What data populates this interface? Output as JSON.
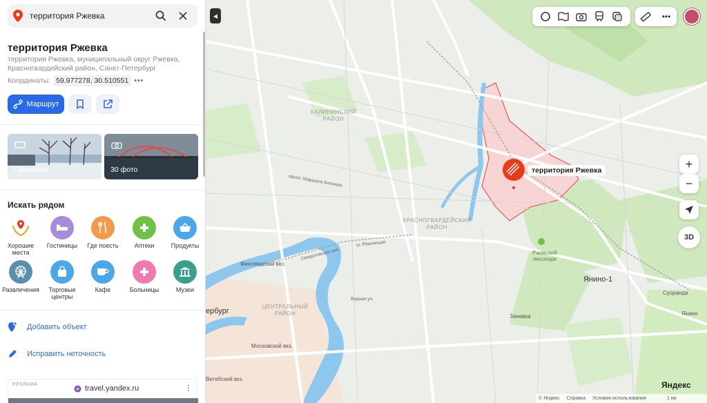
{
  "search": {
    "query": "территория Ржевка",
    "search_icon": "search-icon",
    "close_icon": "close-icon"
  },
  "place": {
    "title": "территория Ржевка",
    "address": "территория Ржевка, муниципальный округ Ржевка, Красногвардейский район, Санкт-Петербург",
    "coords_label": "Координаты:",
    "coords_value": "59.977278, 30.510551",
    "coords_more": "•••"
  },
  "actions": {
    "route_label": "Маршрут",
    "bookmark_icon": "bookmark-icon",
    "share_icon": "share-icon"
  },
  "photos": {
    "panorama_label": "Панорама",
    "photos_label": "30 фото"
  },
  "nearby": {
    "title": "Искать рядом",
    "items": [
      {
        "label": "Хорошие места",
        "icon": "award-icon",
        "color": "#f1f1f1"
      },
      {
        "label": "Гостиницы",
        "icon": "bed-icon",
        "color": "#a88cdc"
      },
      {
        "label": "Где поесть",
        "icon": "fork-knife-icon",
        "color": "#f39a4a"
      },
      {
        "label": "Аптеки",
        "icon": "plus-icon",
        "color": "#6ec246"
      },
      {
        "label": "Продукты",
        "icon": "basket-icon",
        "color": "#4aa8e8"
      },
      {
        "label": "Развлечения",
        "icon": "ferris-wheel-icon",
        "color": "#5a8fb0"
      },
      {
        "label": "Торговые центры",
        "icon": "shopping-bag-icon",
        "color": "#4aa8e8"
      },
      {
        "label": "Кафе",
        "icon": "coffee-icon",
        "color": "#4aa8e8"
      },
      {
        "label": "Больницы",
        "icon": "hospital-icon",
        "color": "#f07ab0"
      },
      {
        "label": "Музеи",
        "icon": "museum-icon",
        "color": "#3aa08a"
      }
    ]
  },
  "links": {
    "add_object": "Добавить объект",
    "fix_error": "Исправить неточность"
  },
  "ad": {
    "tag": "РЕКЛАМА",
    "site": "travel.yandex.ru",
    "menu": "⋮"
  },
  "map": {
    "marker_label": "территория Ржевка",
    "zoom_in": "+",
    "zoom_out": "−",
    "btn_3d": "3D",
    "logo": "Яндекс",
    "footer_copyright": "© Яндекс",
    "footer_help": "Справка",
    "footer_terms": "Условия использования",
    "footer_scale": "1 км",
    "labels": {
      "kalininsky": "КАЛИНИНСКИЙ РАЙОН",
      "krasnogvardeisky": "КРАСНОГВАРДЕЙСКИЙ РАЙОН",
      "central": "ЦЕНТРАЛЬНЫЙ РАЙОН",
      "finland_station": "Финляндский вкз.",
      "moscow_station": "Московский вкз.",
      "vitebsk_station": "Витебский вкз.",
      "petersburg": "ербург",
      "yanino": "Янино-1",
      "zanevka": "Заневка",
      "suoranda": "Суоранда",
      "rzhevsky_park": "Ржевский лесопарк",
      "yanino2": "Янино",
      "revolution": "ш. Революции",
      "mashala": "просп. Маршала Блюхера",
      "vodnaya": "Водная ул.",
      "sverdlovskaya": "Свердловская наб."
    }
  },
  "colors": {
    "accent": "#2a6ae8",
    "marker": "#ea3a1c",
    "river": "#8ec7ee",
    "park": "#c6e8b0",
    "road": "#ffffff",
    "highlight": "#f8c8c8"
  }
}
